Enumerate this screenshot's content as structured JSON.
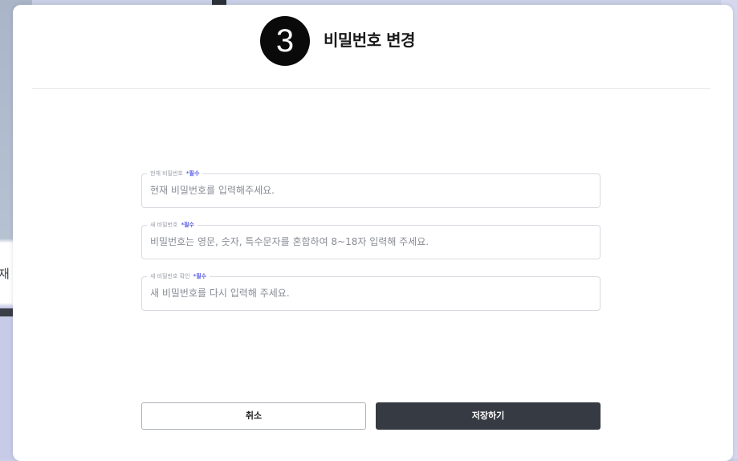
{
  "background": {
    "left_text": "재"
  },
  "modal": {
    "step_number": "3",
    "title": "비밀번호 변경"
  },
  "form": {
    "required_label": "*필수",
    "current_password": {
      "label": "현재 비밀번호",
      "placeholder": "현재 비밀번호를 입력해주세요.",
      "value": ""
    },
    "new_password": {
      "label": "새 비밀번호",
      "placeholder": "비밀번호는 영문, 숫자, 특수문자를 혼합하여 8~18자 입력해 주세요.",
      "value": ""
    },
    "confirm_password": {
      "label": "새 비밀번호 확인",
      "placeholder": "새 비밀번호를 다시 입력해 주세요.",
      "value": ""
    }
  },
  "buttons": {
    "cancel": "취소",
    "save": "저장하기"
  },
  "colors": {
    "required_accent": "#5a5ee6",
    "primary_button": "#363a42",
    "badge": "#0a0a0a"
  }
}
